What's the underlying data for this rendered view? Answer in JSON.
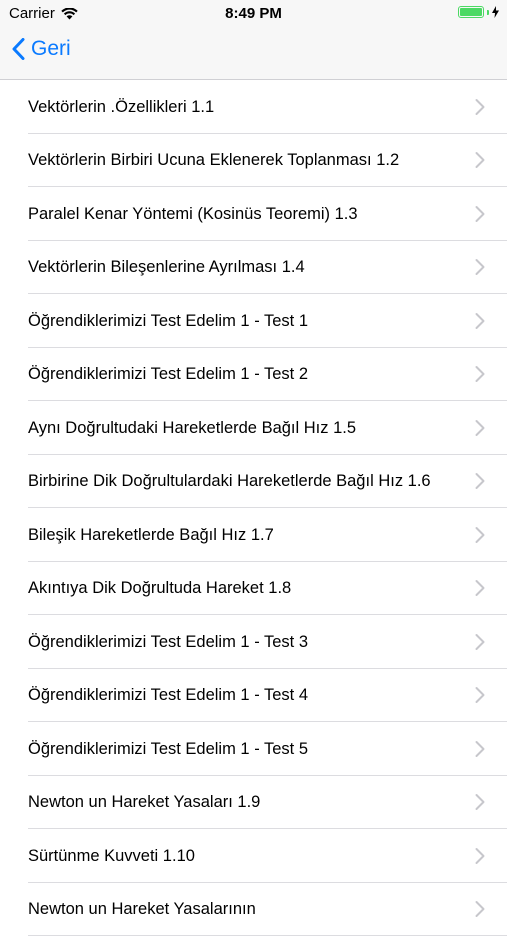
{
  "status": {
    "carrier": "Carrier",
    "time": "8:49 PM",
    "battery_level": 1.0,
    "colors": {
      "battery": "#4cd964"
    }
  },
  "nav": {
    "back_label": "Geri",
    "accent_color": "#0a7aff"
  },
  "list": {
    "items": [
      {
        "label": "Vektörlerin .Özellikleri 1.1"
      },
      {
        "label": "Vektörlerin Birbiri Ucuna Eklenerek Toplanması 1.2"
      },
      {
        "label": "Paralel Kenar Yöntemi (Kosinüs Teoremi) 1.3"
      },
      {
        "label": "Vektörlerin Bileşenlerine Ayrılması 1.4"
      },
      {
        "label": "Öğrendiklerimizi Test Edelim 1 - Test 1"
      },
      {
        "label": "Öğrendiklerimizi Test Edelim 1 - Test 2"
      },
      {
        "label": "Aynı Doğrultudaki Hareketlerde Bağıl Hız 1.5"
      },
      {
        "label": "Birbirine Dik Doğrultulardaki Hareketlerde Bağıl Hız 1.6"
      },
      {
        "label": "Bileşik Hareketlerde Bağıl Hız 1.7"
      },
      {
        "label": "Akıntıya Dik Doğrultuda Hareket 1.8"
      },
      {
        "label": "Öğrendiklerimizi Test Edelim 1 - Test 3"
      },
      {
        "label": "Öğrendiklerimizi Test Edelim 1 - Test 4"
      },
      {
        "label": "Öğrendiklerimizi Test Edelim 1 - Test 5"
      },
      {
        "label": "Newton un Hareket Yasaları 1.9"
      },
      {
        "label": "Sürtünme Kuvveti 1.10"
      },
      {
        "label": "Newton un Hareket Yasalarının"
      }
    ]
  }
}
